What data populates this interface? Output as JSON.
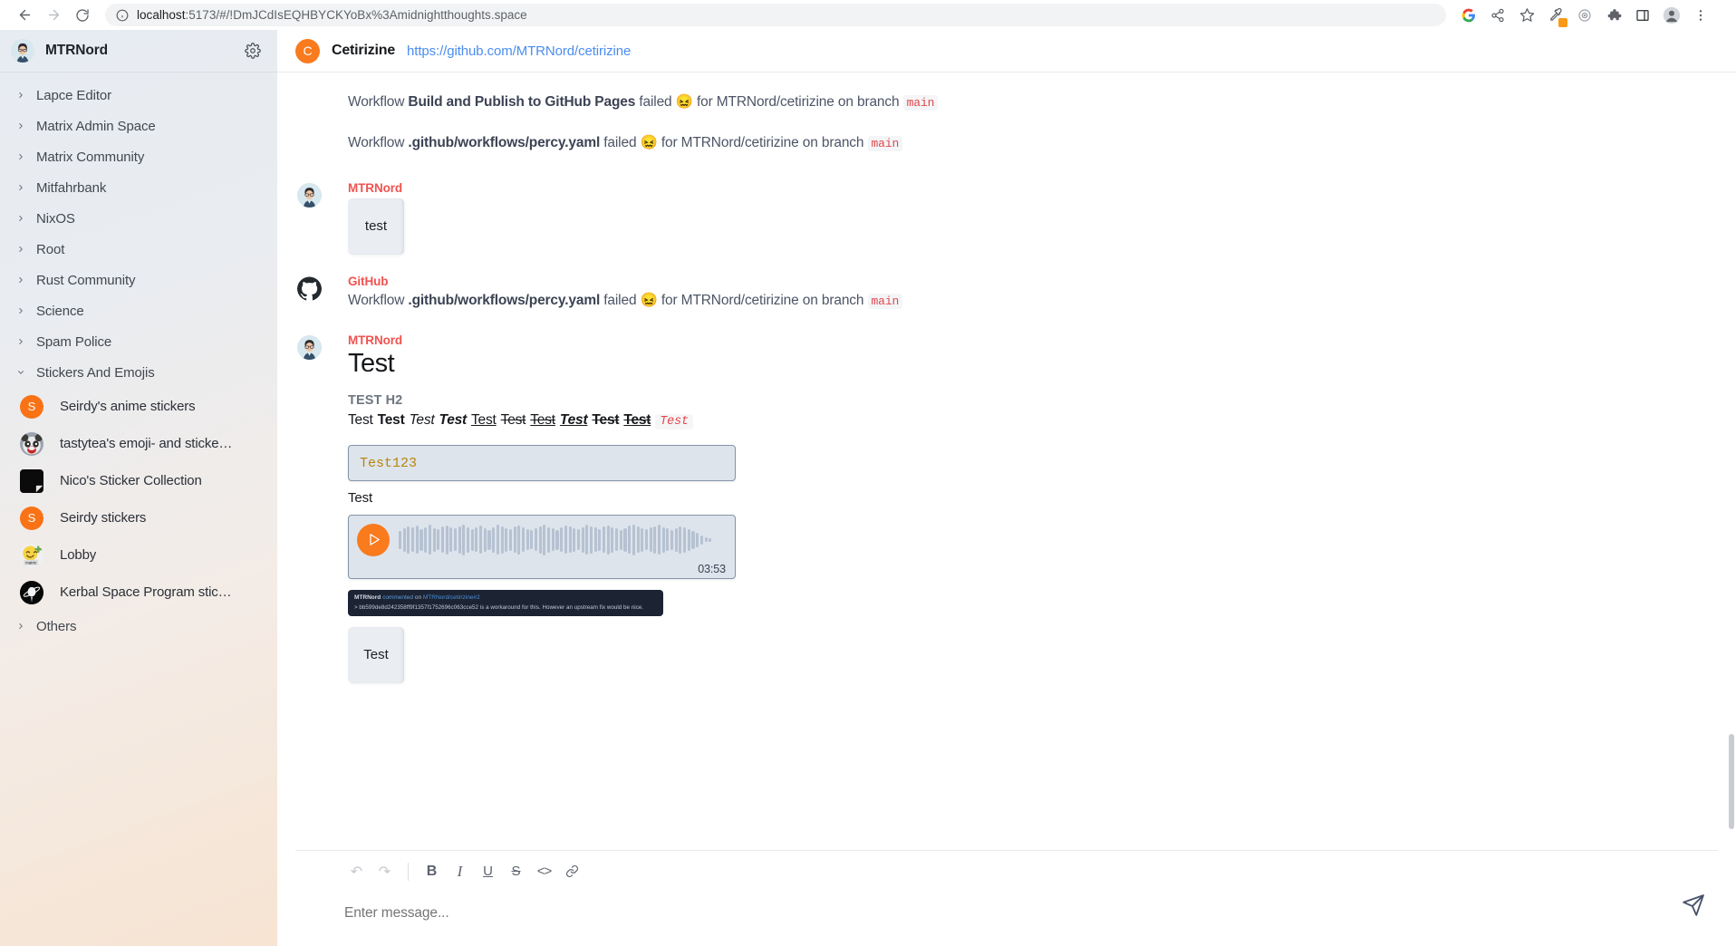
{
  "browser": {
    "url_host": "localhost",
    "url_rest": ":5173/#/!DmJCdIsEQHBYCKYoBx%3Amidnightthoughts.space",
    "back_icon": "back-arrow-icon",
    "forward_icon": "forward-arrow-icon",
    "reload_icon": "reload-icon",
    "info_icon": "site-info-icon",
    "toolbar_icons": [
      "google-icon",
      "share-icon",
      "bookmark-star-icon",
      "eyedropper-icon",
      "target-icon",
      "extensions-puzzle-icon",
      "side-panel-icon",
      "profile-avatar-icon",
      "chrome-menu-icon"
    ]
  },
  "sidebar": {
    "user_name": "MTRNord",
    "settings_icon": "gear-icon",
    "avatar_icon": "user-avatar",
    "spaces": [
      {
        "label": "Lapce Editor",
        "expanded": false
      },
      {
        "label": "Matrix Admin Space",
        "expanded": false
      },
      {
        "label": "Matrix Community",
        "expanded": false
      },
      {
        "label": "Mitfahrbank",
        "expanded": false
      },
      {
        "label": "NixOS",
        "expanded": false
      },
      {
        "label": "Root",
        "expanded": false
      },
      {
        "label": "Rust Community",
        "expanded": false
      },
      {
        "label": "Science",
        "expanded": false
      },
      {
        "label": "Spam Police",
        "expanded": false
      },
      {
        "label": "Stickers And Emojis",
        "expanded": true
      }
    ],
    "rooms": [
      {
        "label": "Seirdy's anime stickers",
        "avatar_kind": "letter",
        "avatar_text": "S",
        "avatar_color": "#f97316"
      },
      {
        "label": "tastytea's emoji- and sticker-...",
        "avatar_kind": "panda",
        "avatar_text": "",
        "avatar_color": "#9aa3ad"
      },
      {
        "label": "Nico's Sticker Collection",
        "avatar_kind": "black-sticker",
        "avatar_text": "",
        "avatar_color": "#0b0b0b"
      },
      {
        "label": "Seirdy stickers",
        "avatar_kind": "letter",
        "avatar_text": "S",
        "avatar_color": "#f97316"
      },
      {
        "label": "Lobby",
        "avatar_kind": "matrix-emoji",
        "avatar_text": "",
        "avatar_color": "#f5d87a"
      },
      {
        "label": "Kerbal Space Program sticker...",
        "avatar_kind": "kerbal",
        "avatar_text": "",
        "avatar_color": "#0b0b0b"
      }
    ],
    "spaces_after": [
      {
        "label": "Others",
        "expanded": false
      }
    ]
  },
  "room": {
    "avatar_letter": "C",
    "avatar_color": "#fa7a1e",
    "title": "Cetirizine",
    "topic": "https://github.com/MTRNord/cetirizine"
  },
  "timeline": {
    "notices": [
      {
        "prefix": "Workflow ",
        "bold": "Build and Publish to GitHub Pages",
        "middle": " failed 😖 for MTRNord/cetirizine on branch ",
        "code": "main"
      },
      {
        "prefix": "Workflow ",
        "bold": ".github/workflows/percy.yaml",
        "middle": " failed 😖 for MTRNord/cetirizine on branch ",
        "code": "main"
      }
    ],
    "messages": [
      {
        "sender": "MTRNord",
        "sender_color": "#ef5350",
        "avatar_kind": "user-avatar",
        "kind": "sticker",
        "sticker_text": "test"
      },
      {
        "sender": "GitHub",
        "sender_color": "#ef5350",
        "avatar_kind": "github-logo",
        "kind": "notice",
        "prefix": "Workflow ",
        "bold": ".github/workflows/percy.yaml",
        "middle": " failed 😖 for MTRNord/cetirizine on branch ",
        "code": "main"
      }
    ],
    "formatting_message": {
      "sender": "MTRNord",
      "sender_color": "#ef5350",
      "avatar_kind": "user-avatar",
      "h1": "Test",
      "h2": "TEST H2",
      "variants": [
        {
          "text": "Test",
          "style": "plain"
        },
        {
          "text": "Test",
          "style": "bold"
        },
        {
          "text": "Test",
          "style": "italic"
        },
        {
          "text": "Test",
          "style": "bold-italic"
        },
        {
          "text": "Test",
          "style": "underline"
        },
        {
          "text": "Test",
          "style": "strike"
        },
        {
          "text": "Test",
          "style": "underline-strike"
        },
        {
          "text": "Test",
          "style": "bold-italic-underline"
        },
        {
          "text": "Test",
          "style": "bold-strike"
        },
        {
          "text": "Test",
          "style": "bold-underline-strike"
        },
        {
          "text": "Test",
          "style": "code"
        }
      ],
      "codeblock": "Test123",
      "plain_text": "Test",
      "audio": {
        "duration": "03:53",
        "play_icon": "play-icon"
      },
      "github_embed": {
        "author": "MTRNord",
        "action": "commented",
        "on": "on",
        "target": "MTRNord/cetirizine#2",
        "quote": "> bb599de8d242358ff9f1357f1752696c063cce52 is a workaround for this. However an upstream fix would be nice."
      },
      "sticker_text": "Test"
    }
  },
  "composer": {
    "buttons": [
      {
        "name": "undo-button",
        "glyph": "↶",
        "disabled": true
      },
      {
        "name": "redo-button",
        "glyph": "↷",
        "disabled": true
      },
      {
        "name": "bold-button",
        "glyph": "B",
        "disabled": false
      },
      {
        "name": "italic-button",
        "glyph": "I",
        "disabled": false
      },
      {
        "name": "underline-button",
        "glyph": "U",
        "disabled": false
      },
      {
        "name": "strikethrough-button",
        "glyph": "S",
        "disabled": false
      },
      {
        "name": "code-button",
        "glyph": "<>",
        "disabled": false
      },
      {
        "name": "link-button",
        "glyph": "🔗",
        "disabled": false
      }
    ],
    "placeholder": "Enter message...",
    "value": "",
    "send_icon": "send-paper-plane-icon"
  },
  "colors": {
    "accent_orange": "#fa7a1e",
    "link_blue": "#4a8df0",
    "sender_red": "#ef5350",
    "code_red": "#e0474c"
  }
}
